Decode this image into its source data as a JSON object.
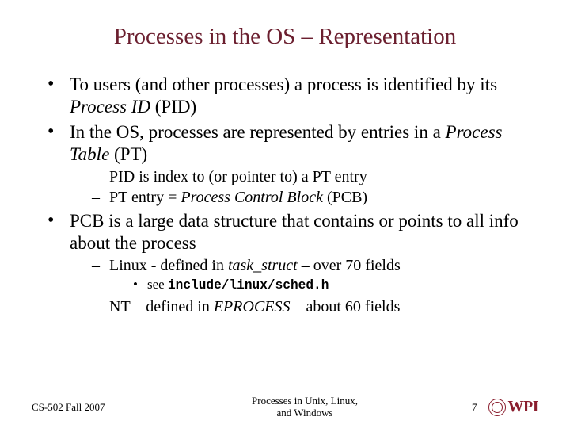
{
  "title": "Processes in the OS – Representation",
  "b1": {
    "pre": "To users (and other processes) a process is identified by its ",
    "em": "Process ID",
    "post": " (PID)"
  },
  "b2": {
    "pre": "In the OS, processes are represented by entries in a ",
    "em": "Process Table",
    "post": " (PT)"
  },
  "b2s1": "PID is index to (or pointer to) a PT entry",
  "b2s2": {
    "pre": "PT entry = ",
    "em": "Process Control Block",
    "post": " (PCB)"
  },
  "b3": "PCB is a large data structure that contains or points to all info about the process",
  "b3s1": {
    "pre": "Linux - defined in ",
    "em": "task_struct",
    "post": " – over 70 fields"
  },
  "b3s1a": {
    "pre": "see ",
    "code": "include/linux/sched.h"
  },
  "b3s2": {
    "pre": "NT – defined in ",
    "em": "EPROCESS",
    "post": " – about 60 fields"
  },
  "footer": {
    "left": "CS-502 Fall 2007",
    "center1": "Processes in Unix, Linux,",
    "center2": "and Windows",
    "page": "7",
    "logo_text": "WPI"
  }
}
